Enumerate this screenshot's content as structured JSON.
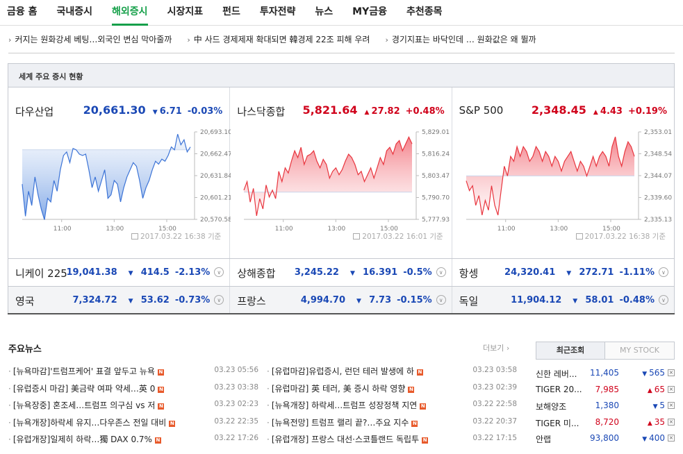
{
  "nav": [
    "금융 홈",
    "국내증시",
    "해외증시",
    "시장지표",
    "펀드",
    "투자전략",
    "뉴스",
    "MY금융",
    "추천종목"
  ],
  "nav_active": 2,
  "headlines": [
    "커지는 원화강세 베팅…외국인 변심 막아줄까",
    "中 사드 경제제재 확대되면 韓경제 22조 피해 우려",
    "경기지표는 바닥인데 … 원화값은 왜 뛸까"
  ],
  "panel_title": "세계 주요 증시 현황",
  "colors": {
    "up": "#d0021b",
    "down": "#1a48b5",
    "active": "#16a04a"
  },
  "cards": [
    {
      "name": "다우산업",
      "price": "20,661.30",
      "change": "6.71",
      "pct": "-0.03%",
      "dir": "down",
      "time": "2017.03.22 16:38 기준",
      "chart_data": {
        "type": "area",
        "x_ticks": [
          "11:00",
          "13:00",
          "15:00"
        ],
        "y_ticks": [
          "20,693.10",
          "20,662.47",
          "20,631.84",
          "20,601.21",
          "20,570.58"
        ],
        "ylim": [
          20570.58,
          20693.1
        ],
        "reference": 20668.01,
        "values": [
          20620,
          20575,
          20610,
          20590,
          20630,
          20605,
          20585,
          20570,
          20600,
          20595,
          20625,
          20610,
          20640,
          20660,
          20665,
          20650,
          20670,
          20668,
          20662,
          20660,
          20662,
          20640,
          20615,
          20630,
          20610,
          20625,
          20640,
          20600,
          20605,
          20625,
          20620,
          20595,
          20615,
          20630,
          20640,
          20650,
          20645,
          20625,
          20600,
          20615,
          20625,
          20640,
          20652,
          20648,
          20655,
          20652,
          20660,
          20672,
          20668,
          20690,
          20675,
          20682,
          20665,
          20672
        ]
      }
    },
    {
      "name": "나스닥종합",
      "price": "5,821.64",
      "change": "27.82",
      "pct": "+0.48%",
      "dir": "up",
      "time": "2017.03.22 16:01 기준",
      "chart_data": {
        "type": "area",
        "x_ticks": [
          "11:00",
          "13:00",
          "15:00"
        ],
        "y_ticks": [
          "5,829.01",
          "5,816.24",
          "5,803.47",
          "5,790.70",
          "5,777.93"
        ],
        "ylim": [
          5777.93,
          5829.01
        ],
        "reference": 5793.82,
        "values": [
          5795,
          5800,
          5788,
          5796,
          5780,
          5790,
          5784,
          5798,
          5791,
          5795,
          5790,
          5806,
          5800,
          5808,
          5805,
          5812,
          5818,
          5814,
          5820,
          5810,
          5815,
          5816,
          5818,
          5812,
          5808,
          5813,
          5810,
          5802,
          5806,
          5808,
          5804,
          5807,
          5812,
          5816,
          5814,
          5810,
          5804,
          5806,
          5800,
          5804,
          5808,
          5802,
          5808,
          5814,
          5810,
          5818,
          5820,
          5816,
          5822,
          5824,
          5818,
          5822,
          5826,
          5822
        ]
      }
    },
    {
      "name": "S&P 500",
      "price": "2,348.45",
      "change": "4.43",
      "pct": "+0.19%",
      "dir": "up",
      "time": "2017.03.22 16:38 기준",
      "chart_data": {
        "type": "area",
        "x_ticks": [
          "11:00",
          "13:00",
          "15:00"
        ],
        "y_ticks": [
          "2,353.01",
          "2,348.54",
          "2,344.07",
          "2,339.60",
          "2,335.13"
        ],
        "ylim": [
          2335.13,
          2353.01
        ],
        "reference": 2344.02,
        "values": [
          2343,
          2341,
          2342,
          2338,
          2340,
          2336,
          2339,
          2337,
          2342,
          2338,
          2336,
          2341,
          2346,
          2344,
          2348,
          2347,
          2350,
          2348,
          2350,
          2349,
          2347,
          2348,
          2350,
          2349,
          2347,
          2349,
          2348,
          2346,
          2348,
          2347,
          2345,
          2347,
          2348,
          2349,
          2347,
          2345,
          2347,
          2346,
          2344,
          2346,
          2348,
          2346,
          2348,
          2349,
          2348,
          2346,
          2350,
          2352,
          2348,
          2346,
          2349,
          2351,
          2350,
          2348
        ]
      }
    }
  ],
  "index_rows": [
    [
      {
        "name": "니케이 225",
        "price": "19,041.38",
        "change": "414.5",
        "pct": "-2.13%",
        "dir": "down"
      },
      {
        "name": "상해종합",
        "price": "3,245.22",
        "change": "16.391",
        "pct": "-0.5%",
        "dir": "down"
      },
      {
        "name": "항셍",
        "price": "24,320.41",
        "change": "272.71",
        "pct": "-1.11%",
        "dir": "down"
      }
    ],
    [
      {
        "name": "영국",
        "price": "7,324.72",
        "change": "53.62",
        "pct": "-0.73%",
        "dir": "down"
      },
      {
        "name": "프랑스",
        "price": "4,994.70",
        "change": "7.73",
        "pct": "-0.15%",
        "dir": "down"
      },
      {
        "name": "독일",
        "price": "11,904.12",
        "change": "58.01",
        "pct": "-0.48%",
        "dir": "down"
      }
    ]
  ],
  "news": {
    "title": "주요뉴스",
    "more": "더보기",
    "left": [
      {
        "t": "[뉴욕마감]'트럼프케어' 표결 앞두고 뉴욕",
        "d": "03.23 05:56"
      },
      {
        "t": "[유럽증시 마감] 美금략 여파 약세…英 0",
        "d": "03.23 03:38"
      },
      {
        "t": "[뉴욕장중] 혼조세…트럼프 의구심 vs 저",
        "d": "03.23 02:23"
      },
      {
        "t": "[뉴욕개장]하락세 유지…다우존스 전일 대비",
        "d": "03.22 22:35"
      },
      {
        "t": "[유럽개장]일제히 하락…獨 DAX 0.7%",
        "d": "03.22 17:26"
      }
    ],
    "right": [
      {
        "t": "[유럽마감]유럽증시, 런던 테러 발생에 하",
        "d": "03.23 03:58"
      },
      {
        "t": "[유럽마감] 英 테러, 美 증시 하락 영향",
        "d": "03.23 02:39"
      },
      {
        "t": "[뉴욕개장] 하락세…트럼프 성장정책 지연",
        "d": "03.22 22:58"
      },
      {
        "t": "[뉴욕전망] 트럼프 랠리 끝?…주요 지수",
        "d": "03.22 20:37"
      },
      {
        "t": "[유럽개장] 프랑스 대선·스코틀랜드 독립투",
        "d": "03.22 17:15"
      }
    ]
  },
  "side": {
    "tab_active": "최근조회",
    "tab_inactive": "MY STOCK",
    "stocks": [
      {
        "name": "신한 레버...",
        "price": "11,405",
        "change": "565",
        "dir": "down"
      },
      {
        "name": "TIGER 20...",
        "price": "7,985",
        "change": "65",
        "dir": "up"
      },
      {
        "name": "보해양조",
        "price": "1,380",
        "change": "5",
        "dir": "down"
      },
      {
        "name": "TIGER 미...",
        "price": "8,720",
        "change": "35",
        "dir": "up"
      },
      {
        "name": "안랩",
        "price": "93,800",
        "change": "400",
        "dir": "down"
      }
    ]
  }
}
